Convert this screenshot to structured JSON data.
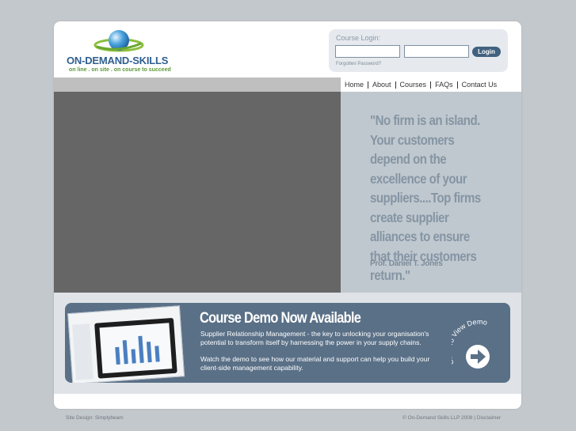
{
  "logo": {
    "name": "ON-DEMAND-SKILLS",
    "tagline": "on line . on site . on course to succeed"
  },
  "login": {
    "title": "Course Login:",
    "button_label": "Login",
    "forgot_label": "Forgotten Password?"
  },
  "nav": {
    "items": [
      {
        "label": "Home"
      },
      {
        "label": "About"
      },
      {
        "label": "Courses"
      },
      {
        "label": "FAQs"
      },
      {
        "label": "Contact Us"
      }
    ]
  },
  "quote": {
    "text": "\"No firm is an island. Your customers depend on the excellence of your suppliers....Top firms create supplier alliances to ensure that their customers return.\"",
    "author": "Prof. Daniel T. Jones"
  },
  "demo": {
    "title": "Course Demo Now Available",
    "description": "Supplier Relationship Management - the key to unlocking your organisation's potential to transform itself by harnessing the power in your supply chains.",
    "description2": "Watch the demo to see how our material and support can help you build your client-side management capability.",
    "cta": "Click To View Demo"
  },
  "footer": {
    "left": "Site Design: Simplybeam",
    "right": "© On-Demand Skills LLP 2008 | Disclaimer"
  },
  "colors": {
    "background": "#c3c8cc",
    "accent": "#41627f",
    "demo_panel": "#5a7087",
    "quote_panel": "#c0c8cf",
    "logo_green": "#5c9a3a"
  }
}
